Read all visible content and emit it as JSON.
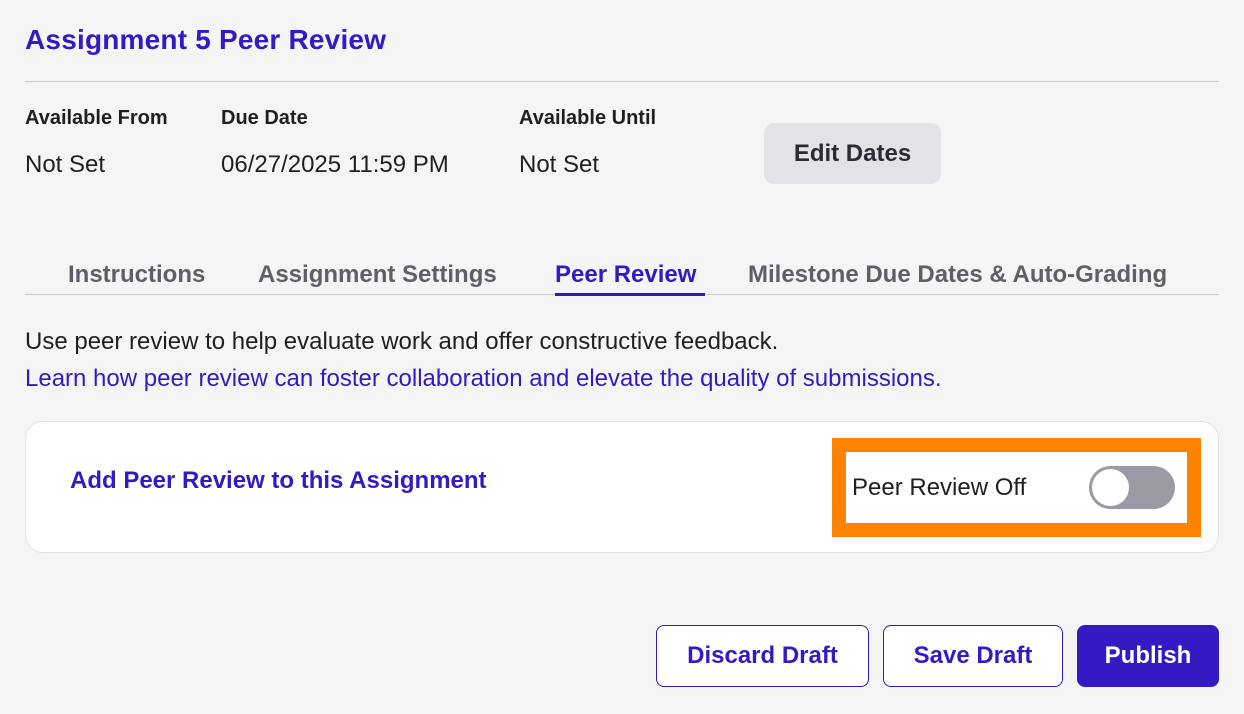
{
  "header": {
    "title": "Assignment 5 Peer Review"
  },
  "dates": {
    "available_from": {
      "label": "Available From",
      "value": "Not Set"
    },
    "due_date": {
      "label": "Due Date",
      "value": "06/27/2025 11:59 PM"
    },
    "available_until": {
      "label": "Available Until",
      "value": "Not Set"
    },
    "edit_label": "Edit Dates"
  },
  "tabs": [
    {
      "label": "Instructions",
      "active": false
    },
    {
      "label": "Assignment Settings",
      "active": false
    },
    {
      "label": "Peer Review",
      "active": true
    },
    {
      "label": "Milestone Due Dates & Auto-Grading",
      "active": false
    }
  ],
  "content": {
    "intro": "Use peer review to help evaluate work and offer constructive feedback.",
    "learn_link": "Learn how peer review can foster collaboration and elevate the quality of submissions."
  },
  "card": {
    "heading": "Add Peer Review to this Assignment",
    "toggle_label": "Peer Review Off",
    "toggle_on": false
  },
  "footer": {
    "discard_label": "Discard Draft",
    "save_label": "Save Draft",
    "publish_label": "Publish"
  },
  "colors": {
    "accent": "#3519c3",
    "highlight": "#ff8200",
    "toggle_off": "#9a99a4",
    "background": "#f5f5f5"
  }
}
